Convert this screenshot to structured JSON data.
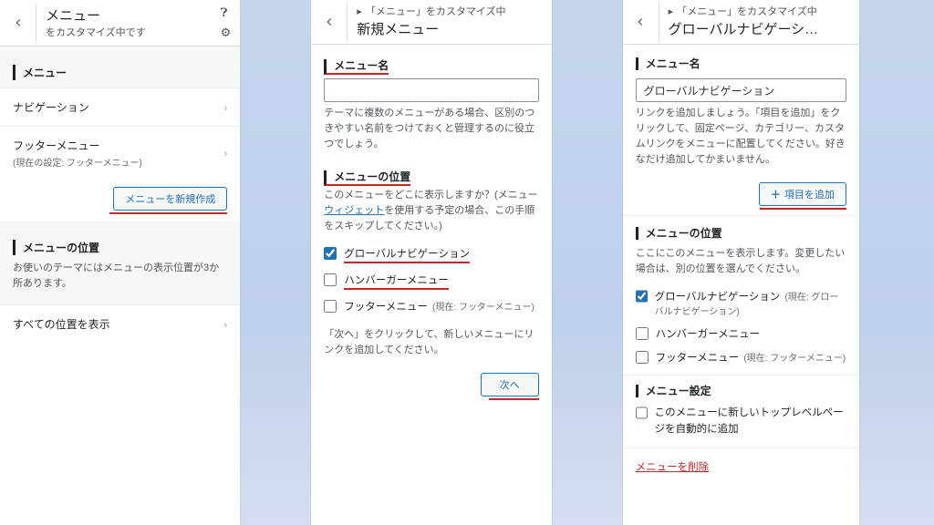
{
  "panel1": {
    "title": "メニュー",
    "subtitle": "をカスタマイズ中です",
    "section_menu": "メニュー",
    "rows": [
      {
        "label": "ナビゲーション"
      },
      {
        "label": "フッターメニュー",
        "sub": "(現在の設定: フッターメニュー)"
      }
    ],
    "create_btn": "メニューを新規作成",
    "pos_heading": "メニューの位置",
    "pos_desc": "お使いのテーマにはメニューの表示位置が3か所あります。",
    "pos_row": "すべての位置を表示"
  },
  "panel2": {
    "crumb": "「メニュー」をカスタマイズ中",
    "title": "新規メニュー",
    "name_heading": "メニュー名",
    "name_value": "",
    "name_desc": "テーマに複数のメニューがある場合、区別のつきやすい名前をつけておくと管理するのに役立つでしょう。",
    "pos_heading": "メニューの位置",
    "pos_desc_a": "このメニューをどこに表示しますか？(メニュー",
    "pos_desc_link": "ウィジェット",
    "pos_desc_b": "を使用する予定の場合、この手順をスキップしてください。)",
    "checks": [
      {
        "label": "グローバルナビゲーション",
        "checked": true,
        "underline": true
      },
      {
        "label": "ハンバーガーメニュー",
        "checked": false,
        "underline": true
      },
      {
        "label": "フッターメニュー",
        "checked": false,
        "sub": "(現在: フッターメニュー)"
      }
    ],
    "next_desc": "「次へ」をクリックして、新しいメニューにリンクを追加してください。",
    "next_btn": "次へ"
  },
  "panel3": {
    "crumb": "「メニュー」をカスタマイズ中",
    "title": "グローバルナビゲーシ…",
    "name_heading": "メニュー名",
    "name_value": "グローバルナビゲーション",
    "add_desc": "リンクを追加しましょう。「項目を追加」をクリックして、固定ページ、カテゴリー、カスタムリンクをメニューに配置してください。好きなだけ追加してかまいません。",
    "add_btn": "項目を追加",
    "pos_heading": "メニューの位置",
    "pos_desc": "ここにこのメニューを表示します。変更したい場合は、別の位置を選んでください。",
    "checks": [
      {
        "label": "グローバルナビゲーション",
        "checked": true,
        "sub": "(現在: グローバルナビゲーション)"
      },
      {
        "label": "ハンバーガーメニュー",
        "checked": false
      },
      {
        "label": "フッターメニュー",
        "checked": false,
        "sub": "(現在: フッターメニュー)"
      }
    ],
    "settings_heading": "メニュー設定",
    "auto_add": "このメニューに新しいトップレベルページを自動的に追加",
    "delete": "メニューを削除"
  }
}
